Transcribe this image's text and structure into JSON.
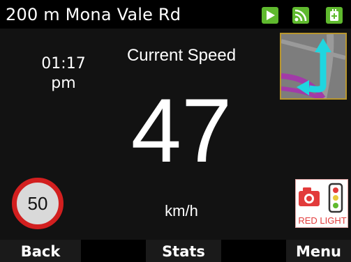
{
  "header": {
    "street": "200 m Mona Vale Rd",
    "icons": [
      "route-arrow-icon",
      "gps-signal-icon",
      "battery-icon"
    ],
    "icon_color": "#5fb92e"
  },
  "clock": {
    "time": "01:17",
    "ampm": "pm"
  },
  "speed": {
    "label": "Current Speed",
    "value": "47",
    "unit": "km/h"
  },
  "speed_limit": {
    "value": "50",
    "ring_color": "#d21f1f"
  },
  "red_light": {
    "label": "RED LIGHT",
    "icon": "red-light-camera-icon"
  },
  "map": {
    "icon": "turn-arrow-icon",
    "arrow_color": "#1fd6e0",
    "road_color": "#a23ba8"
  },
  "softkeys": {
    "back": "Back",
    "stats": "Stats",
    "menu": "Menu"
  }
}
